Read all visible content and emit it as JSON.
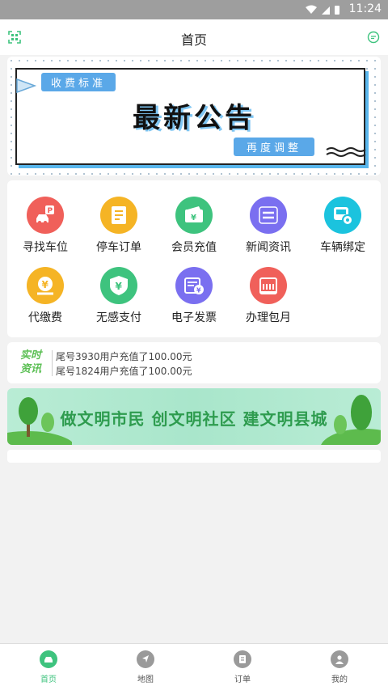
{
  "status": {
    "time": "11:24"
  },
  "header": {
    "title": "首页"
  },
  "banner": {
    "tag_top": "收费标准",
    "headline": "最新公告",
    "tag_bottom": "再度调整"
  },
  "grid": {
    "items": [
      {
        "label": "寻找车位",
        "icon": "parking-car-icon",
        "color": "#f0605a"
      },
      {
        "label": "停车订单",
        "icon": "order-list-icon",
        "color": "#f5b425"
      },
      {
        "label": "会员充值",
        "icon": "wallet-recharge-icon",
        "color": "#3ec37e"
      },
      {
        "label": "新闻资讯",
        "icon": "news-icon",
        "color": "#7a6ff0"
      },
      {
        "label": "车辆绑定",
        "icon": "vehicle-settings-icon",
        "color": "#1bc3de"
      },
      {
        "label": "代缴费",
        "icon": "coin-payment-icon",
        "color": "#f5b425"
      },
      {
        "label": "无感支付",
        "icon": "yuan-shield-icon",
        "color": "#3ec37e"
      },
      {
        "label": "电子发票",
        "icon": "invoice-icon",
        "color": "#7a6ff0"
      },
      {
        "label": "办理包月",
        "icon": "monthly-pass-icon",
        "color": "#f0605a"
      }
    ]
  },
  "news": {
    "tag": "实时资讯",
    "tag_line1": "实时",
    "tag_line2": "资讯",
    "lines": [
      "尾号3930用户充值了100.00元",
      "尾号1824用户充值了100.00元"
    ]
  },
  "promo": {
    "text": "做文明市民  创文明社区  建文明县城"
  },
  "tabs": [
    {
      "label": "首页",
      "icon": "car-icon",
      "active": true
    },
    {
      "label": "地图",
      "icon": "navigation-icon",
      "active": false
    },
    {
      "label": "订单",
      "icon": "order-icon",
      "active": false
    },
    {
      "label": "我的",
      "icon": "user-icon",
      "active": false
    }
  ],
  "colors": {
    "accent": "#3ec37e",
    "inactive_tab": "#9a9a9a",
    "text": "#222222"
  }
}
